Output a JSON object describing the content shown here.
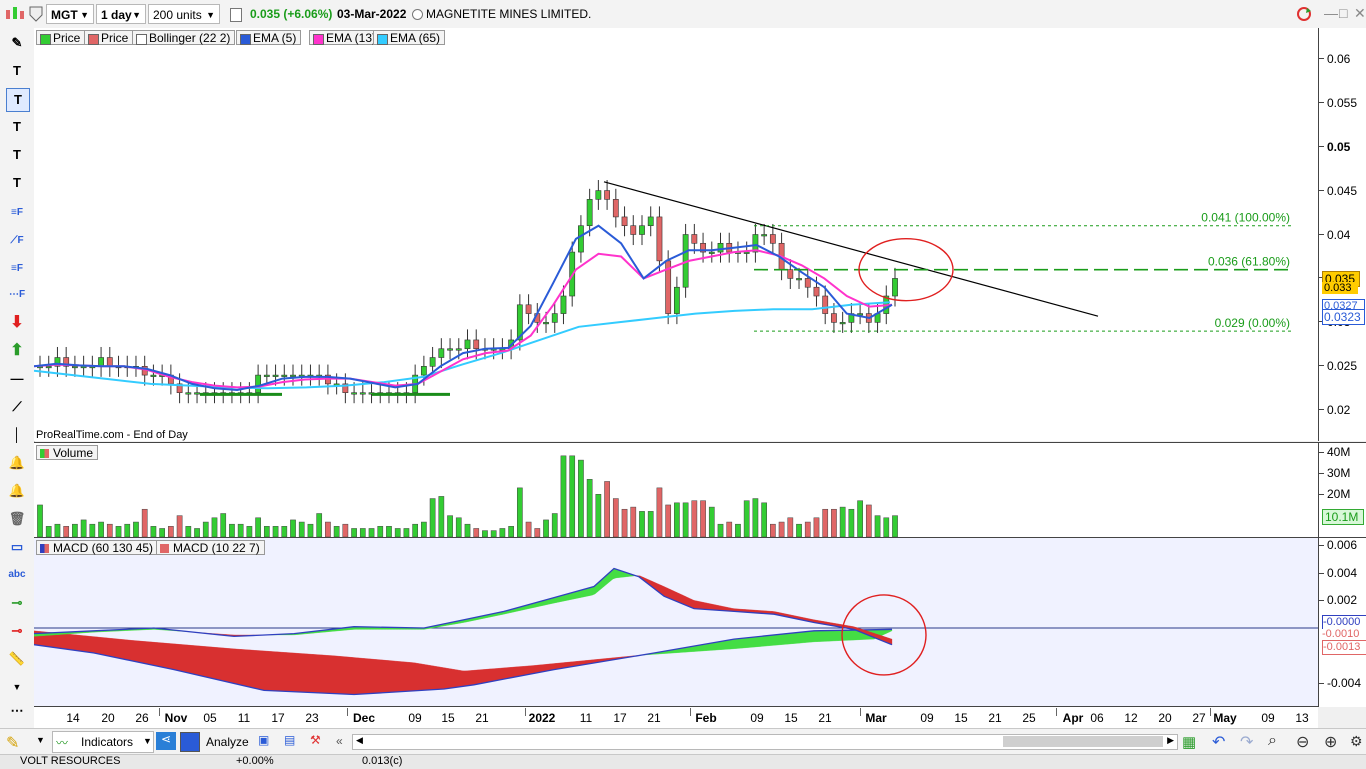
{
  "toolbar": {
    "ticker": "MGT",
    "timeframe": "1 day",
    "units": "200 units",
    "change": "0.035 (+6.06%)",
    "date": "03-Mar-2022",
    "company": "MAGNETITE MINES LIMITED."
  },
  "price_pane": {
    "indicators": [
      {
        "label": "Price",
        "color": "#33cc33"
      },
      {
        "label": "Price",
        "color": "#e06666"
      },
      {
        "label": "Bollinger (22 2)",
        "color": "#ffffff"
      },
      {
        "label": "EMA (5)",
        "color": "#2a5bd7"
      },
      {
        "label": "EMA (13)",
        "color": "#ff33cc"
      },
      {
        "label": "EMA (65)",
        "color": "#33ccff"
      }
    ],
    "source_note": "ProRealTime.com - End of Day",
    "fib_levels": [
      {
        "label": "0.041 (100.00%)",
        "value": 0.041
      },
      {
        "label": "0.036 (61.80%)",
        "value": 0.036
      },
      {
        "label": "0.029 (0.00%)",
        "value": 0.029
      }
    ],
    "price_tags": {
      "last": "0.035",
      "prev": "0.033",
      "ema_fast": "0.0327",
      "ema_slow": "0.0323"
    }
  },
  "volume_pane": {
    "title": "Volume",
    "last_tag": "10.1M"
  },
  "macd_pane": {
    "indicators": [
      {
        "label": "MACD (60 130 45)",
        "color": "#3040c0"
      },
      {
        "label": "MACD (10 22 7)",
        "color": "#e06666"
      }
    ],
    "tags": {
      "a": "-0.0000",
      "b": "-0.0010",
      "c": "-0.0013"
    }
  },
  "bottom": {
    "indicators_label": "Indicators",
    "analyze_label": "Analyze"
  },
  "status": {
    "name": "VOLT RESOURCES",
    "pct": "+0.00%",
    "price": "0.013(c)"
  },
  "colors": {
    "up": "#33cc33",
    "down": "#e06666",
    "ema5": "#2a5bd7",
    "ema13": "#ff33cc",
    "ema65": "#33ccff"
  },
  "chart_data": [
    {
      "type": "candlestick",
      "title": "MGT",
      "x_ticks": [
        "14",
        "20",
        "26",
        "Nov",
        "05",
        "11",
        "17",
        "23",
        "Dec",
        "09",
        "15",
        "21",
        "2022",
        "11",
        "17",
        "21",
        "Feb",
        "09",
        "15",
        "21",
        "Mar",
        "09",
        "15",
        "21",
        "25",
        "Apr",
        "06",
        "12",
        "20",
        "27",
        "May",
        "09",
        "13"
      ],
      "y_ticks": [
        0.06,
        0.055,
        0.05,
        0.045,
        0.04,
        0.035,
        0.03,
        0.025,
        0.02
      ],
      "ylim": [
        0.0165,
        0.0635
      ],
      "series": [
        {
          "name": "Price (close)",
          "values": [
            0.025,
            0.025,
            0.026,
            0.025,
            0.025,
            0.025,
            0.025,
            0.026,
            0.025,
            0.025,
            0.025,
            0.025,
            0.024,
            0.024,
            0.024,
            0.023,
            0.022,
            0.022,
            0.022,
            0.022,
            0.022,
            0.022,
            0.022,
            0.022,
            0.022,
            0.024,
            0.024,
            0.024,
            0.024,
            0.024,
            0.024,
            0.024,
            0.024,
            0.023,
            0.023,
            0.022,
            0.022,
            0.022,
            0.022,
            0.022,
            0.022,
            0.022,
            0.022,
            0.024,
            0.025,
            0.026,
            0.027,
            0.027,
            0.027,
            0.028,
            0.027,
            0.027,
            0.027,
            0.027,
            0.028,
            0.032,
            0.031,
            0.03,
            0.03,
            0.031,
            0.033,
            0.038,
            0.041,
            0.044,
            0.045,
            0.044,
            0.042,
            0.041,
            0.04,
            0.041,
            0.042,
            0.037,
            0.031,
            0.034,
            0.04,
            0.039,
            0.038,
            0.038,
            0.039,
            0.038,
            0.038,
            0.038,
            0.04,
            0.04,
            0.039,
            0.036,
            0.035,
            0.035,
            0.034,
            0.033,
            0.031,
            0.03,
            0.03,
            0.031,
            0.031,
            0.03,
            0.031,
            0.033,
            0.035
          ]
        },
        {
          "name": "EMA (5)",
          "values": [
            0.025,
            0.0253,
            0.0251,
            0.025,
            0.025,
            0.0247,
            0.024,
            0.023,
            0.0225,
            0.0223,
            0.0228,
            0.0236,
            0.0238,
            0.0238,
            0.0236,
            0.0231,
            0.0226,
            0.023,
            0.025,
            0.0265,
            0.027,
            0.0271,
            0.0296,
            0.0345,
            0.0395,
            0.041,
            0.039,
            0.035,
            0.037,
            0.0382,
            0.0382,
            0.0385,
            0.0388,
            0.0375,
            0.0357,
            0.034,
            0.031,
            0.0305,
            0.032
          ]
        },
        {
          "name": "EMA (13)",
          "values": [
            0.025,
            0.0252,
            0.0251,
            0.025,
            0.025,
            0.0246,
            0.0238,
            0.0232,
            0.0228,
            0.0226,
            0.0227,
            0.0232,
            0.0235,
            0.0236,
            0.0236,
            0.0232,
            0.0228,
            0.023,
            0.0244,
            0.0258,
            0.0265,
            0.0268,
            0.0285,
            0.032,
            0.036,
            0.0378,
            0.0375,
            0.035,
            0.036,
            0.037,
            0.0375,
            0.038,
            0.0382,
            0.0376,
            0.0365,
            0.035,
            0.033,
            0.0318,
            0.032
          ]
        },
        {
          "name": "EMA (65)",
          "values": [
            0.0245,
            0.024,
            0.0235,
            0.023,
            0.0228,
            0.0226,
            0.0225,
            0.0226,
            0.0228,
            0.0232,
            0.0238,
            0.0252,
            0.0265,
            0.028,
            0.0295,
            0.03,
            0.0305,
            0.031,
            0.0313,
            0.0315,
            0.0315,
            0.032,
            0.0323
          ]
        }
      ]
    },
    {
      "type": "bar",
      "title": "Volume",
      "y_ticks": [
        "40M",
        "30M",
        "20M",
        "10M"
      ],
      "ylim": [
        0,
        44
      ],
      "series": [
        {
          "name": "Volume (M)",
          "values": [
            15,
            5,
            6,
            5,
            6,
            8,
            6,
            7,
            6,
            5,
            6,
            7,
            13,
            5,
            4,
            5,
            10,
            5,
            4,
            7,
            9,
            11,
            6,
            6,
            5,
            9,
            5,
            5,
            5,
            8,
            7,
            6,
            11,
            7,
            5,
            6,
            4,
            4,
            4,
            5,
            5,
            4,
            4,
            6,
            7,
            18,
            19,
            10,
            9,
            6,
            4,
            3,
            3,
            4,
            5,
            23,
            7,
            4,
            8,
            11,
            38,
            38,
            36,
            27,
            20,
            26,
            18,
            13,
            14,
            12,
            12,
            23,
            15,
            16,
            16,
            17,
            17,
            14,
            6,
            7,
            6,
            17,
            18,
            16,
            6,
            7,
            9,
            6,
            7,
            9,
            13,
            13,
            14,
            13,
            17,
            15,
            10,
            9,
            10
          ]
        }
      ]
    },
    {
      "type": "area",
      "title": "MACD",
      "y_ticks": [
        0.006,
        0.004,
        0.002,
        -0.004
      ],
      "ylim": [
        -0.0057,
        0.0065
      ]
    }
  ]
}
